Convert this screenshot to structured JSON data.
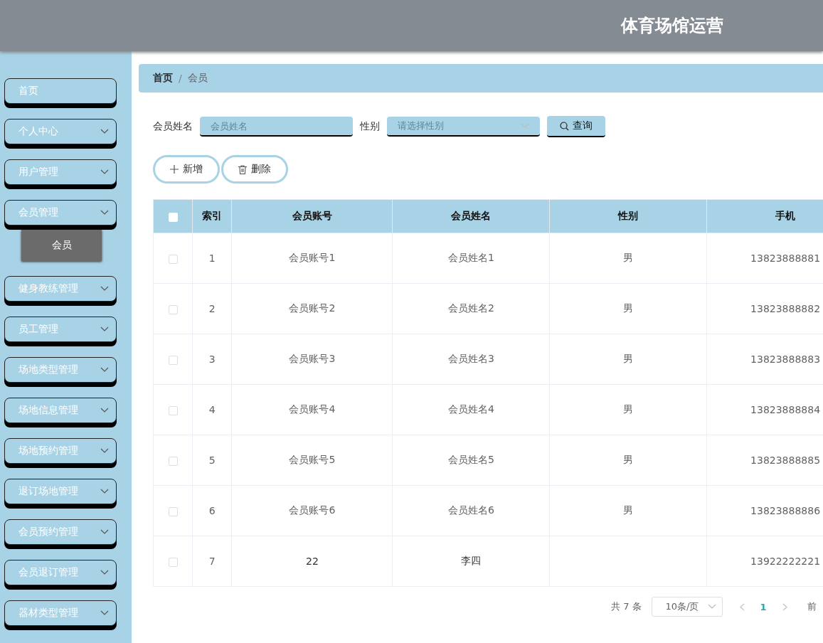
{
  "header": {
    "title": "体育场馆运营"
  },
  "sidebar": {
    "items": [
      {
        "label": "首页",
        "kind": "link"
      },
      {
        "label": "个人中心",
        "kind": "submenu"
      },
      {
        "label": "用户管理",
        "kind": "submenu"
      },
      {
        "label": "会员管理",
        "kind": "submenu",
        "children": [
          {
            "label": "会员",
            "selected": true
          }
        ]
      },
      {
        "label": "健身教练管理",
        "kind": "submenu"
      },
      {
        "label": "员工管理",
        "kind": "submenu"
      },
      {
        "label": "场地类型管理",
        "kind": "submenu"
      },
      {
        "label": "场地信息管理",
        "kind": "submenu"
      },
      {
        "label": "场地预约管理",
        "kind": "submenu"
      },
      {
        "label": "退订场地管理",
        "kind": "submenu"
      },
      {
        "label": "会员预约管理",
        "kind": "submenu"
      },
      {
        "label": "会员退订管理",
        "kind": "submenu"
      },
      {
        "label": "器材类型管理",
        "kind": "submenu"
      }
    ]
  },
  "breadcrumb": {
    "separator": "/",
    "items": [
      {
        "label": "首页"
      },
      {
        "label": "会员"
      }
    ]
  },
  "search": {
    "fields": [
      {
        "label": "会员姓名",
        "kind": "input",
        "placeholder": "会员姓名"
      },
      {
        "label": "性别",
        "kind": "select",
        "placeholder": "请选择性别"
      }
    ],
    "button": "查询"
  },
  "actions": [
    {
      "label": "新增",
      "kind": "add"
    },
    {
      "label": "删除",
      "kind": "delete"
    }
  ],
  "table": {
    "header_checked": false,
    "columns": [
      "索引",
      "会员账号",
      "会员姓名",
      "性别",
      "手机"
    ],
    "rows": [
      {
        "checked": false,
        "cells": [
          "1",
          "会员账号1",
          "会员姓名1",
          "男",
          "13823888881"
        ]
      },
      {
        "checked": false,
        "cells": [
          "2",
          "会员账号2",
          "会员姓名2",
          "男",
          "13823888882"
        ]
      },
      {
        "checked": false,
        "cells": [
          "3",
          "会员账号3",
          "会员姓名3",
          "男",
          "13823888883"
        ]
      },
      {
        "checked": false,
        "cells": [
          "4",
          "会员账号4",
          "会员姓名4",
          "男",
          "13823888884"
        ]
      },
      {
        "checked": false,
        "cells": [
          "5",
          "会员账号5",
          "会员姓名5",
          "男",
          "13823888885"
        ]
      },
      {
        "checked": false,
        "cells": [
          "6",
          "会员账号6",
          "会员姓名6",
          "男",
          "13823888886"
        ]
      },
      {
        "checked": false,
        "cells": [
          "7",
          "22",
          "李四",
          "",
          "13922222221"
        ]
      }
    ]
  },
  "pagination": {
    "total": "共 7 条",
    "page_size": "10条/页",
    "pages": [
      {
        "label": "1",
        "selected": true
      }
    ],
    "goto": "前"
  }
}
